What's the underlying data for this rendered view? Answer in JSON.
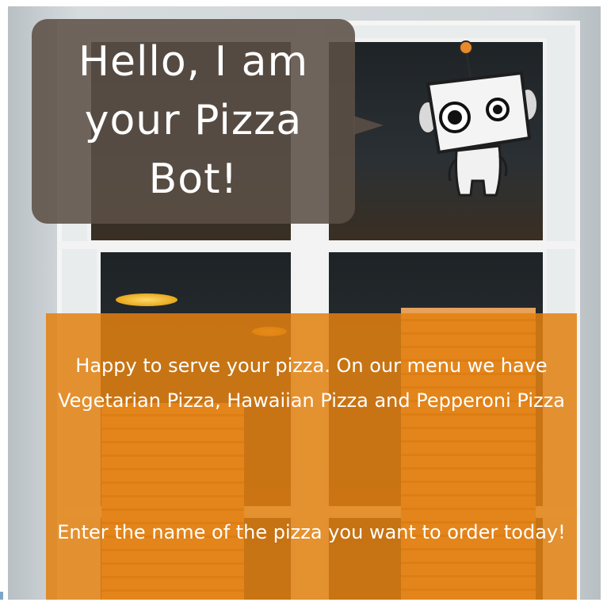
{
  "bot": {
    "greeting": "Hello, I am your Pizza Bot!",
    "icon": "robot-icon"
  },
  "info": {
    "intro": "Happy to serve your pizza. On our menu we have Vegetarian Pizza, Hawaiian Pizza and Pepperoni Pizza",
    "prompt": "Enter the name of the pizza you want to order today!"
  },
  "colors": {
    "bubble": "#5c5046",
    "panel": "#e28010",
    "text": "#ffffff",
    "robot_antenna": "#e8892a"
  }
}
